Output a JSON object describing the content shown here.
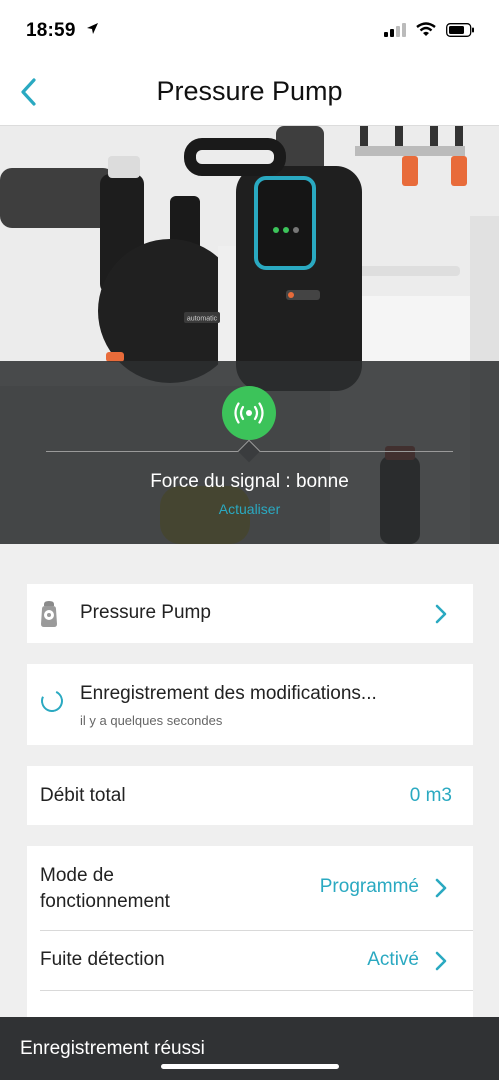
{
  "status_bar": {
    "time": "18:59"
  },
  "nav": {
    "title": "Pressure Pump"
  },
  "hero": {
    "pump_badge": "automatic",
    "signal_text": "Force du signal : bonne",
    "refresh_label": "Actualiser"
  },
  "device_row": {
    "label": "Pressure Pump"
  },
  "saving": {
    "title": "Enregistrement des modifications...",
    "subtitle": "il y a quelques secondes"
  },
  "flow": {
    "label": "Débit total",
    "value": "0 m3"
  },
  "settings": [
    {
      "label": "Mode de fonctionnement",
      "value": "Programmé"
    },
    {
      "label": "Fuite détection",
      "value": "Activé"
    }
  ],
  "toast": {
    "text": "Enregistrement réussi"
  },
  "colors": {
    "accent": "#2aa9c1",
    "signal_good": "#3cc35a",
    "toast_bg": "#303234"
  },
  "icons": [
    "location-arrow-icon",
    "cellular-signal-icon",
    "wifi-icon",
    "battery-icon",
    "back-chevron-icon",
    "broadcast-signal-icon",
    "pump-device-icon",
    "chevron-right-icon",
    "spinner-icon"
  ]
}
